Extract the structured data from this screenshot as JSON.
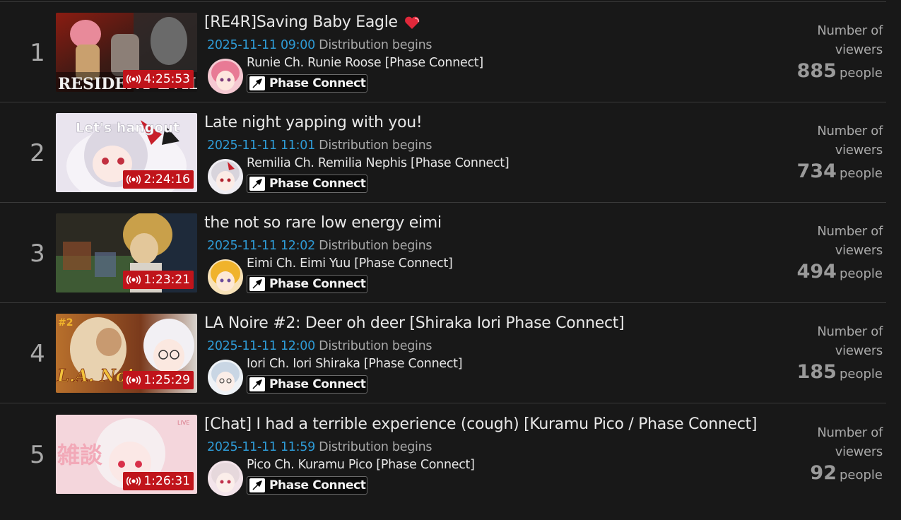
{
  "streams": [
    {
      "rank": "1",
      "title": "[RE4R]Saving Baby Eagle",
      "title_icon": "heart-icon",
      "date": "2025-11-11 09:00",
      "date_suffix": "Distribution begins",
      "channel": "Runie Ch. Runie Roose [Phase Connect]",
      "group": "Phase Connect",
      "duration": "4:25:53",
      "thumb_text": "RESIDENT EVIL 4",
      "viewers_label": "Number of viewers",
      "viewers": "885",
      "viewers_unit": "people"
    },
    {
      "rank": "2",
      "title": "Late night yapping with you!",
      "date": "2025-11-11 11:01",
      "date_suffix": "Distribution begins",
      "channel": "Remilia Ch. Remilia Nephis [Phase Connect]",
      "group": "Phase Connect",
      "duration": "2:24:16",
      "thumb_text": "Let's hangout",
      "viewers_label": "Number of viewers",
      "viewers": "734",
      "viewers_unit": "people"
    },
    {
      "rank": "3",
      "title": "the not so rare low energy eimi",
      "date": "2025-11-11 12:02",
      "date_suffix": "Distribution begins",
      "channel": "Eimi Ch. Eimi Yuu [Phase Connect]",
      "group": "Phase Connect",
      "duration": "1:23:21",
      "viewers_label": "Number of viewers",
      "viewers": "494",
      "viewers_unit": "people"
    },
    {
      "rank": "4",
      "title": "LA Noire #2: Deer oh deer [Shiraka Iori Phase Connect]",
      "date": "2025-11-11 12:00",
      "date_suffix": "Distribution begins",
      "channel": "Iori Ch. Iori Shiraka [Phase Connect]",
      "group": "Phase Connect",
      "duration": "1:25:29",
      "thumb_text": "L.A. Noire",
      "thumb_tag": "#2",
      "viewers_label": "Number of viewers",
      "viewers": "185",
      "viewers_unit": "people"
    },
    {
      "rank": "5",
      "title": "[Chat] I had a terrible experience (cough) [Kuramu Pico / Phase Connect]",
      "date": "2025-11-11 11:59",
      "date_suffix": "Distribution begins",
      "channel": "Pico Ch. Kuramu Pico [Phase Connect]",
      "group": "Phase Connect",
      "duration": "1:26:31",
      "thumb_text": "雑談",
      "thumb_tag": "LIVE",
      "viewers_label": "Number of viewers",
      "viewers": "92",
      "viewers_unit": "people"
    }
  ],
  "colors": {
    "background": "#181818",
    "date": "#2e9bd6",
    "live_badge": "#c0141b",
    "muted": "#a9a9a9"
  }
}
